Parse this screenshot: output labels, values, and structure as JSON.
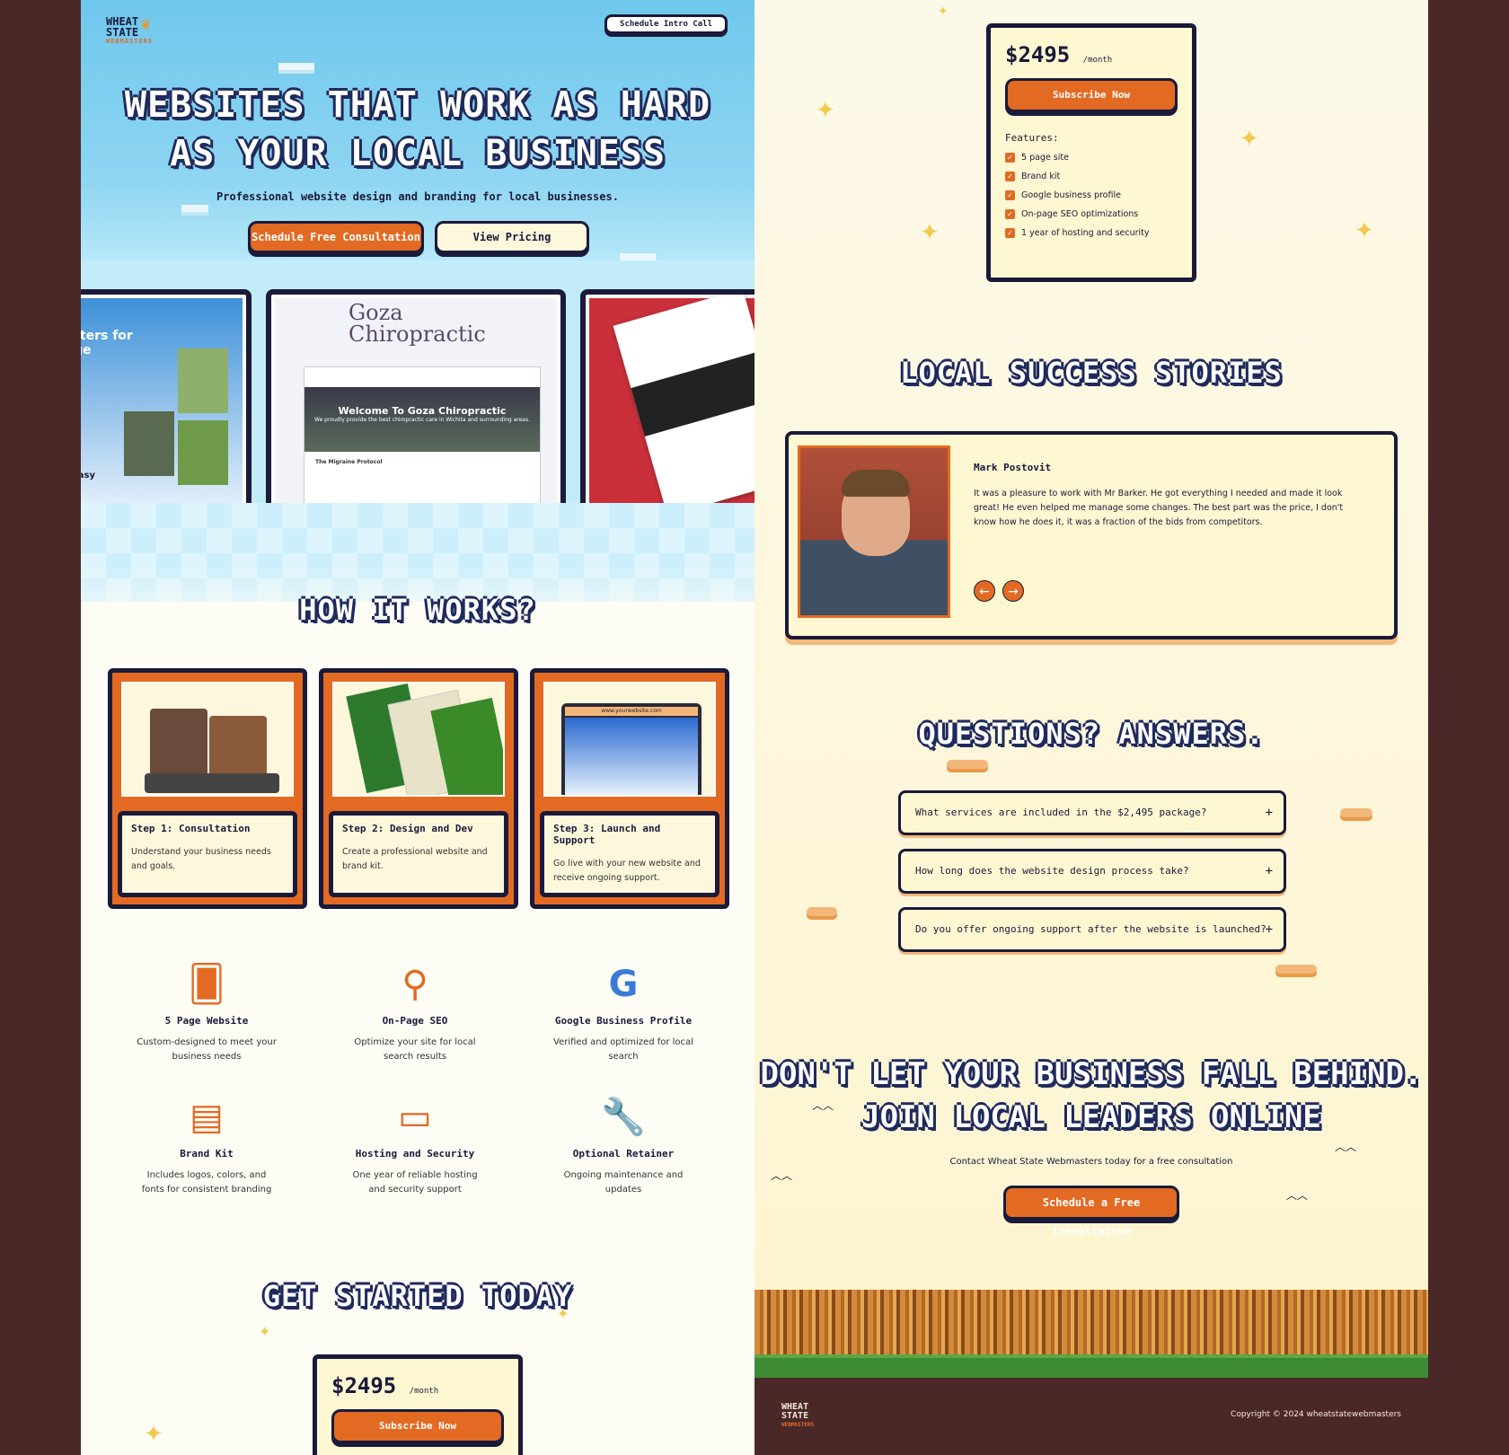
{
  "brand": {
    "line1": "WHEAT",
    "line2": "STATE",
    "line3": "WEBMASTERS"
  },
  "header": {
    "intro_button": "Schedule Intro Call"
  },
  "hero": {
    "title_line1": "WEBSITES THAT WORK AS HARD",
    "title_line2": "AS YOUR LOCAL BUSINESS",
    "subtitle": "Professional website design and branding for local businesses.",
    "primary_button": "Schedule Free Consultation",
    "secondary_button": "View Pricing"
  },
  "portfolio": {
    "shot1_text": "rters for\nge",
    "shot1_easy": "easy",
    "shot2_brand_line1": "Goza",
    "shot2_brand_line2": "Chiropractic",
    "shot2_banner": "Welcome To Goza Chiropractic",
    "shot2_banner_sub": "We proudly provide the best chiropractic care in Wichita and surrounding areas.",
    "shot2_sub": "The Migraine Protocol"
  },
  "how_it_works": {
    "title": "HOW IT WORKS?",
    "steps": [
      {
        "title": "Step 1: Consultation",
        "text": "Understand your business needs and goals."
      },
      {
        "title": "Step 2: Design and Dev",
        "text": "Create a professional website and brand kit."
      },
      {
        "title": "Step 3: Launch and Support",
        "text": "Go live with your new website and receive ongoing support."
      }
    ],
    "step3_url": "www.yourwebsite.com"
  },
  "features": [
    {
      "icon": "cards-icon",
      "title": "5 Page Website",
      "text": "Custom-designed to meet your business needs"
    },
    {
      "icon": "magnifier-icon",
      "title": "On-Page SEO",
      "text": "Optimize your site for local search results"
    },
    {
      "icon": "google-icon",
      "title": "Google Business Profile",
      "text": "Verified and optimized for local search"
    },
    {
      "icon": "palette-cards-icon",
      "title": "Brand Kit",
      "text": "Includes logos, colors, and fonts for consistent branding"
    },
    {
      "icon": "monitor-icon",
      "title": "Hosting and Security",
      "text": "One year of reliable hosting and security support"
    },
    {
      "icon": "wrench-icon",
      "title": "Optional Retainer",
      "text": "Ongoing maintenance and updates"
    }
  ],
  "pricing": {
    "title": "GET STARTED TODAY",
    "price": "$2495",
    "period": "/month",
    "button": "Subscribe Now",
    "features_label": "Features:",
    "features": [
      "5 page site",
      "Brand kit",
      "Google business profile",
      "On-page SEO optimizations",
      "1 year of hosting and security"
    ]
  },
  "testimonials": {
    "title": "LOCAL SUCCESS STORIES",
    "name": "Mark Postovit",
    "quote": "It was a pleasure to work with Mr Barker. He got everything I needed and made it look great! He even helped me manage some changes. The best part was the price, I don't know how he does it, it was a fraction of the bids from competitors.",
    "prev": "←",
    "next": "→"
  },
  "faq": {
    "title": "QUESTIONS? ANSWERS.",
    "items": [
      "What services are included in the $2,495 package?",
      "How long does the website design process take?",
      "Do you offer ongoing support after the website is launched?"
    ],
    "toggle": "+"
  },
  "cta": {
    "title_line1": "DON'T LET YOUR BUSINESS FALL BEHIND.",
    "title_line2": "JOIN LOCAL LEADERS ONLINE",
    "subtitle": "Contact Wheat State Webmasters today for a free consultation",
    "button": "Schedule a Free Consultation"
  },
  "footer": {
    "copyright": "Copyright © 2024 wheatstatewebmasters"
  },
  "colors": {
    "accent": "#e36a22",
    "navy": "#1a1a3a",
    "cream": "#fdf7d2",
    "sky": "#6fc7ec",
    "background": "#4a2828"
  }
}
